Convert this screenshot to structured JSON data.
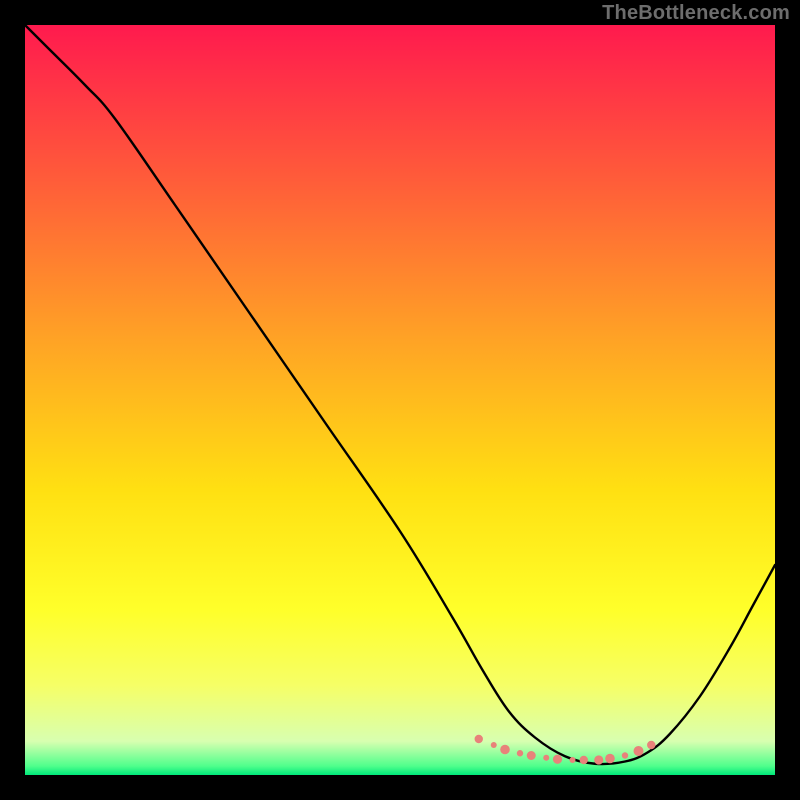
{
  "watermark": "TheBottleneck.com",
  "chart_data": {
    "type": "line",
    "title": "",
    "xlabel": "",
    "ylabel": "",
    "xlim": [
      0,
      100
    ],
    "ylim": [
      0,
      100
    ],
    "grid": false,
    "legend": false,
    "gradient_stops": [
      {
        "offset": 0.0,
        "color": "#ff1a4e"
      },
      {
        "offset": 0.2,
        "color": "#ff5a3a"
      },
      {
        "offset": 0.42,
        "color": "#ffa325"
      },
      {
        "offset": 0.62,
        "color": "#ffe012"
      },
      {
        "offset": 0.78,
        "color": "#ffff2a"
      },
      {
        "offset": 0.88,
        "color": "#f6ff66"
      },
      {
        "offset": 0.955,
        "color": "#d8ffb0"
      },
      {
        "offset": 0.988,
        "color": "#50ff8c"
      },
      {
        "offset": 1.0,
        "color": "#00e87a"
      }
    ],
    "series": [
      {
        "name": "bottleneck-curve",
        "color": "#000000",
        "x": [
          0.0,
          3.0,
          8.0,
          12.0,
          20.0,
          30.0,
          40.0,
          50.0,
          57.0,
          61.0,
          64.5,
          68.0,
          72.0,
          76.0,
          80.0,
          83.0,
          86.0,
          90.0,
          94.0,
          97.0,
          100.0
        ],
        "y": [
          100.0,
          97.0,
          92.0,
          87.5,
          76.0,
          61.5,
          47.0,
          32.5,
          21.0,
          14.0,
          8.5,
          5.0,
          2.5,
          1.5,
          1.8,
          3.0,
          5.5,
          10.5,
          17.0,
          22.5,
          28.0
        ]
      }
    ],
    "markers": {
      "name": "valley-dots",
      "color": "#e8827a",
      "radius_pattern": [
        4.2,
        3.0,
        4.8,
        3.2,
        4.5,
        3.0,
        4.6,
        3.0,
        4.2,
        4.6,
        4.8,
        3.2,
        5.0,
        4.2
      ],
      "x": [
        60.5,
        62.5,
        64.0,
        66.0,
        67.5,
        69.5,
        71.0,
        73.0,
        74.5,
        76.5,
        78.0,
        80.0,
        81.8,
        83.5
      ],
      "y": [
        4.8,
        4.0,
        3.4,
        2.9,
        2.6,
        2.3,
        2.1,
        2.0,
        2.0,
        2.0,
        2.2,
        2.6,
        3.2,
        4.0
      ]
    }
  }
}
